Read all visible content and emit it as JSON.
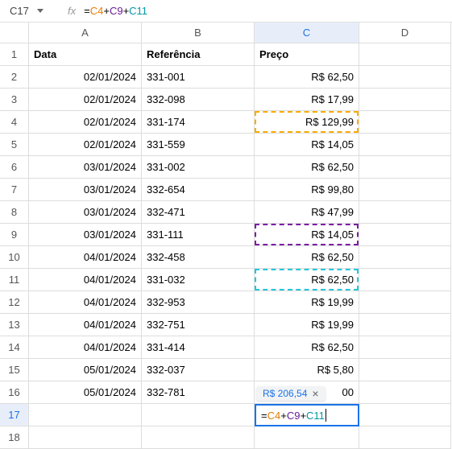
{
  "nameBox": "C17",
  "formulaBar": {
    "eq": "=",
    "ref1": "C4",
    "plus": "+",
    "ref2": "C9",
    "ref3": "C11"
  },
  "columns": {
    "A": "A",
    "B": "B",
    "C": "C",
    "D": "D"
  },
  "headers": {
    "A": "Data",
    "B": "Referência",
    "C": "Preço"
  },
  "rows": [
    {
      "n": "1"
    },
    {
      "n": "2",
      "A": "02/01/2024",
      "B": "331-001",
      "C": "R$ 62,50"
    },
    {
      "n": "3",
      "A": "02/01/2024",
      "B": "332-098",
      "C": "R$ 17,99"
    },
    {
      "n": "4",
      "A": "02/01/2024",
      "B": "331-174",
      "C": "R$ 129,99"
    },
    {
      "n": "5",
      "A": "02/01/2024",
      "B": "331-559",
      "C": "R$ 14,05"
    },
    {
      "n": "6",
      "A": "03/01/2024",
      "B": "331-002",
      "C": "R$ 62,50"
    },
    {
      "n": "7",
      "A": "03/01/2024",
      "B": "332-654",
      "C": "R$ 99,80"
    },
    {
      "n": "8",
      "A": "03/01/2024",
      "B": "332-471",
      "C": "R$ 47,99"
    },
    {
      "n": "9",
      "A": "03/01/2024",
      "B": "331-111",
      "C": "R$ 14,05"
    },
    {
      "n": "10",
      "A": "04/01/2024",
      "B": "332-458",
      "C": "R$ 62,50"
    },
    {
      "n": "11",
      "A": "04/01/2024",
      "B": "331-032",
      "C": "R$ 62,50"
    },
    {
      "n": "12",
      "A": "04/01/2024",
      "B": "332-953",
      "C": "R$ 19,99"
    },
    {
      "n": "13",
      "A": "04/01/2024",
      "B": "332-751",
      "C": "R$ 19,99"
    },
    {
      "n": "14",
      "A": "04/01/2024",
      "B": "331-414",
      "C": "R$ 62,50"
    },
    {
      "n": "15",
      "A": "05/01/2024",
      "B": "332-037",
      "C": "R$ 5,80"
    },
    {
      "n": "16",
      "A": "05/01/2024",
      "B": "332-781",
      "C": "00"
    },
    {
      "n": "17"
    },
    {
      "n": "18"
    }
  ],
  "tooltip": {
    "value": "R$ 206,54",
    "close": "×"
  }
}
